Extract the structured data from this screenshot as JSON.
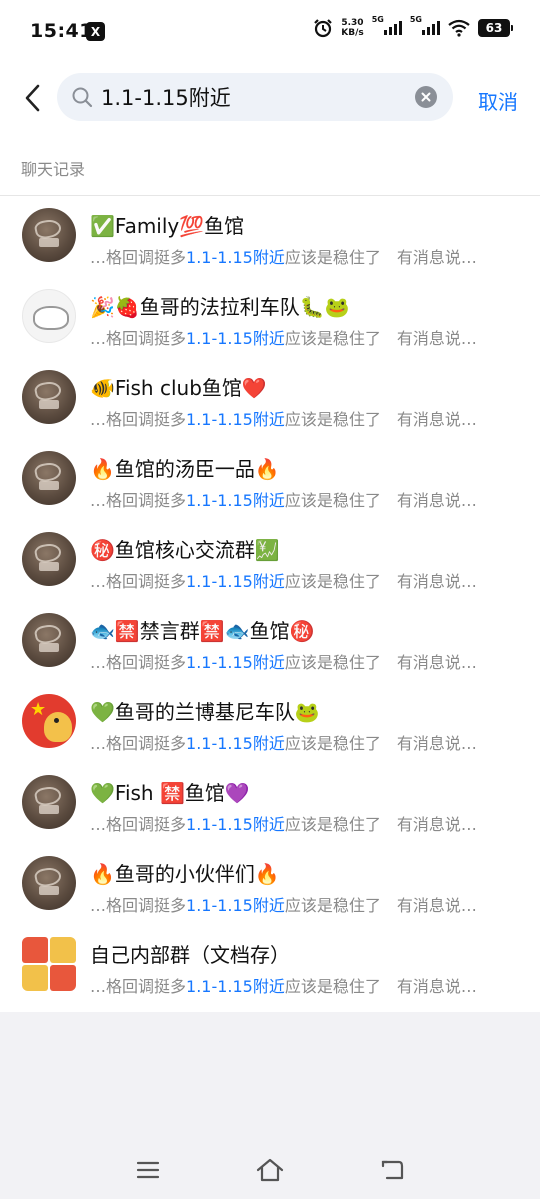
{
  "status": {
    "time": "15:41",
    "app_badge": "X",
    "speed_value": "5.30",
    "speed_unit": "KB/s",
    "net1": "5G",
    "net2": "5G",
    "battery": "63"
  },
  "search": {
    "query": "1.1-1.15附近",
    "cancel_label": "取消"
  },
  "section_title": "聊天记录",
  "results": [
    {
      "title": "✅Family💯鱼馆",
      "avatar": "dark",
      "snippet_pre": "…格回调挺多",
      "snippet_hl": "1.1-1.15附近",
      "snippet_post": "应该是稳住了　有消息说…"
    },
    {
      "title": "🎉🍓鱼哥的法拉利车队🐛🐸",
      "avatar": "light",
      "snippet_pre": "…格回调挺多",
      "snippet_hl": "1.1-1.15附近",
      "snippet_post": "应该是稳住了　有消息说…"
    },
    {
      "title": "🐠Fish  club鱼馆❤️",
      "avatar": "dark",
      "snippet_pre": "…格回调挺多",
      "snippet_hl": "1.1-1.15附近",
      "snippet_post": "应该是稳住了　有消息说…"
    },
    {
      "title": "🔥鱼馆的汤臣一品🔥",
      "avatar": "dark",
      "snippet_pre": "…格回调挺多",
      "snippet_hl": "1.1-1.15附近",
      "snippet_post": "应该是稳住了　有消息说…"
    },
    {
      "title": "㊙️鱼馆核心交流群💹",
      "avatar": "dark",
      "snippet_pre": "…格回调挺多",
      "snippet_hl": "1.1-1.15附近",
      "snippet_post": "应该是稳住了　有消息说…"
    },
    {
      "title": "🐟🈲禁言群🈲🐟鱼馆㊙️",
      "avatar": "dark",
      "snippet_pre": "…格回调挺多",
      "snippet_hl": "1.1-1.15附近",
      "snippet_post": "应该是稳住了　有消息说…"
    },
    {
      "title": "💚鱼哥的兰博基尼车队🐸",
      "avatar": "flag",
      "snippet_pre": "…格回调挺多",
      "snippet_hl": "1.1-1.15附近",
      "snippet_post": "应该是稳住了　有消息说…"
    },
    {
      "title": "💚Fish  🈲鱼馆💜",
      "avatar": "dark",
      "snippet_pre": "…格回调挺多",
      "snippet_hl": "1.1-1.15附近",
      "snippet_post": "应该是稳住了　有消息说…"
    },
    {
      "title": "🔥鱼哥的小伙伴们🔥",
      "avatar": "dark",
      "snippet_pre": "…格回调挺多",
      "snippet_hl": "1.1-1.15附近",
      "snippet_post": "应该是稳住了　有消息说…"
    },
    {
      "title": "自己内部群（文档存）",
      "avatar": "grid",
      "snippet_pre": "…格回调挺多",
      "snippet_hl": "1.1-1.15附近",
      "snippet_post": "应该是稳住了　有消息说…"
    }
  ],
  "colors": {
    "accent": "#1677ff",
    "snippet": "#8a8a8a",
    "background": "#f2f2f5"
  },
  "icons": [
    "alarm-icon",
    "wifi-icon",
    "back-arrow-icon",
    "search-icon",
    "clear-icon",
    "menu-icon",
    "home-icon",
    "return-icon"
  ]
}
